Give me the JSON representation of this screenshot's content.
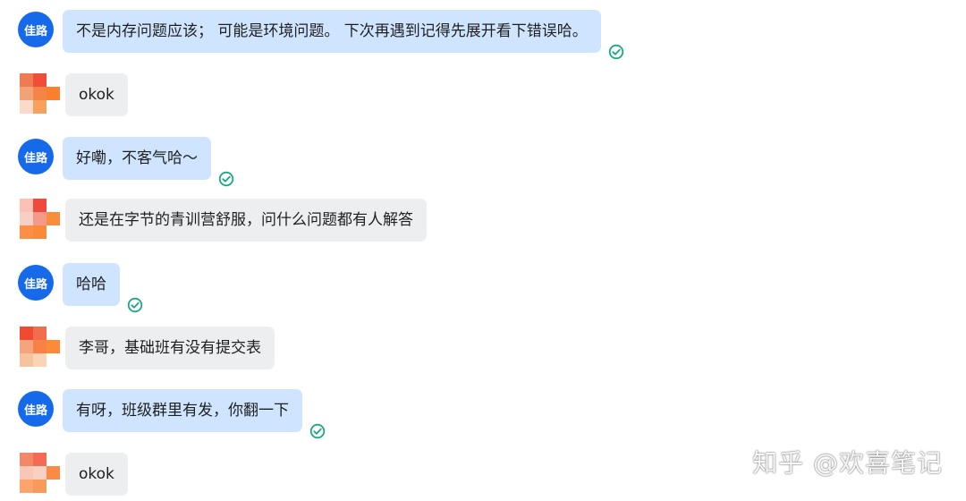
{
  "me": {
    "avatar_text": "佳路"
  },
  "messages": [
    {
      "sender": "me",
      "text": "不是内存问题应该； 可能是环境问题。 下次再遇到记得先展开看下错误哈。",
      "status": "read"
    },
    {
      "sender": "other",
      "text": "okok"
    },
    {
      "sender": "me",
      "text": "好嘞，不客气哈～",
      "status": "read"
    },
    {
      "sender": "other",
      "text": "还是在字节的青训营舒服，问什么问题都有人解答"
    },
    {
      "sender": "me",
      "text": "哈哈",
      "status": "read"
    },
    {
      "sender": "other",
      "text": "李哥，基础班有没有提交表"
    },
    {
      "sender": "me",
      "text": "有呀，班级群里有发，你翻一下",
      "status": "read"
    },
    {
      "sender": "other",
      "text": "okok"
    }
  ],
  "watermark": "知乎 @欢喜笔记",
  "colors": {
    "my_avatar": "#1669e8",
    "my_bubble": "#cfe5ff",
    "other_bubble": "#eceeef",
    "read_check": "#18a883"
  },
  "icons": {
    "read_status": "check-circle-icon",
    "other_avatar": "pixelated-avatar"
  }
}
